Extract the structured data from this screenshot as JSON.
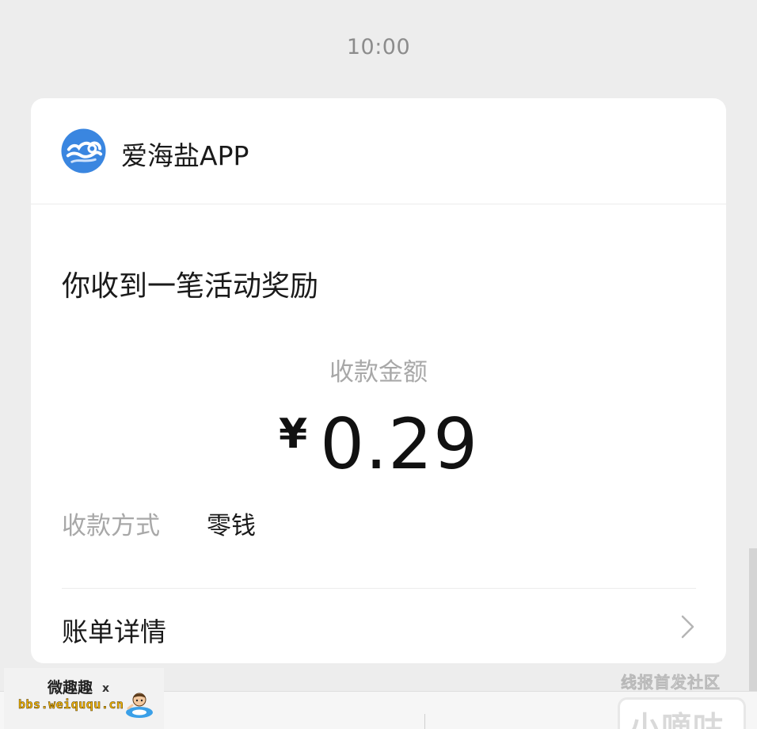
{
  "message": {
    "time": "10:00"
  },
  "card": {
    "app": {
      "name": "爱海盐APP",
      "logo_icon": "wave-logo-icon",
      "brand_color": "#3a86e0"
    },
    "headline": "你收到一笔活动奖励",
    "amount": {
      "label": "收款金额",
      "currency": "¥",
      "value": "0.29"
    },
    "payment_method": {
      "label": "收款方式",
      "value": "零钱"
    },
    "details_link": {
      "label": "账单详情",
      "icon": "chevron-right-icon"
    }
  },
  "watermarks": {
    "left_title": "微趣趣",
    "left_mark": "x",
    "left_url": "bbs.weiququ.cn",
    "right_text": "线报首发社区",
    "brand_text": "小嘀咕"
  },
  "colors": {
    "background": "#ededed",
    "card": "#ffffff",
    "primary_text": "#1a1a1a",
    "secondary_text": "#a8a8a8",
    "url_watermark": "#f2b400"
  }
}
